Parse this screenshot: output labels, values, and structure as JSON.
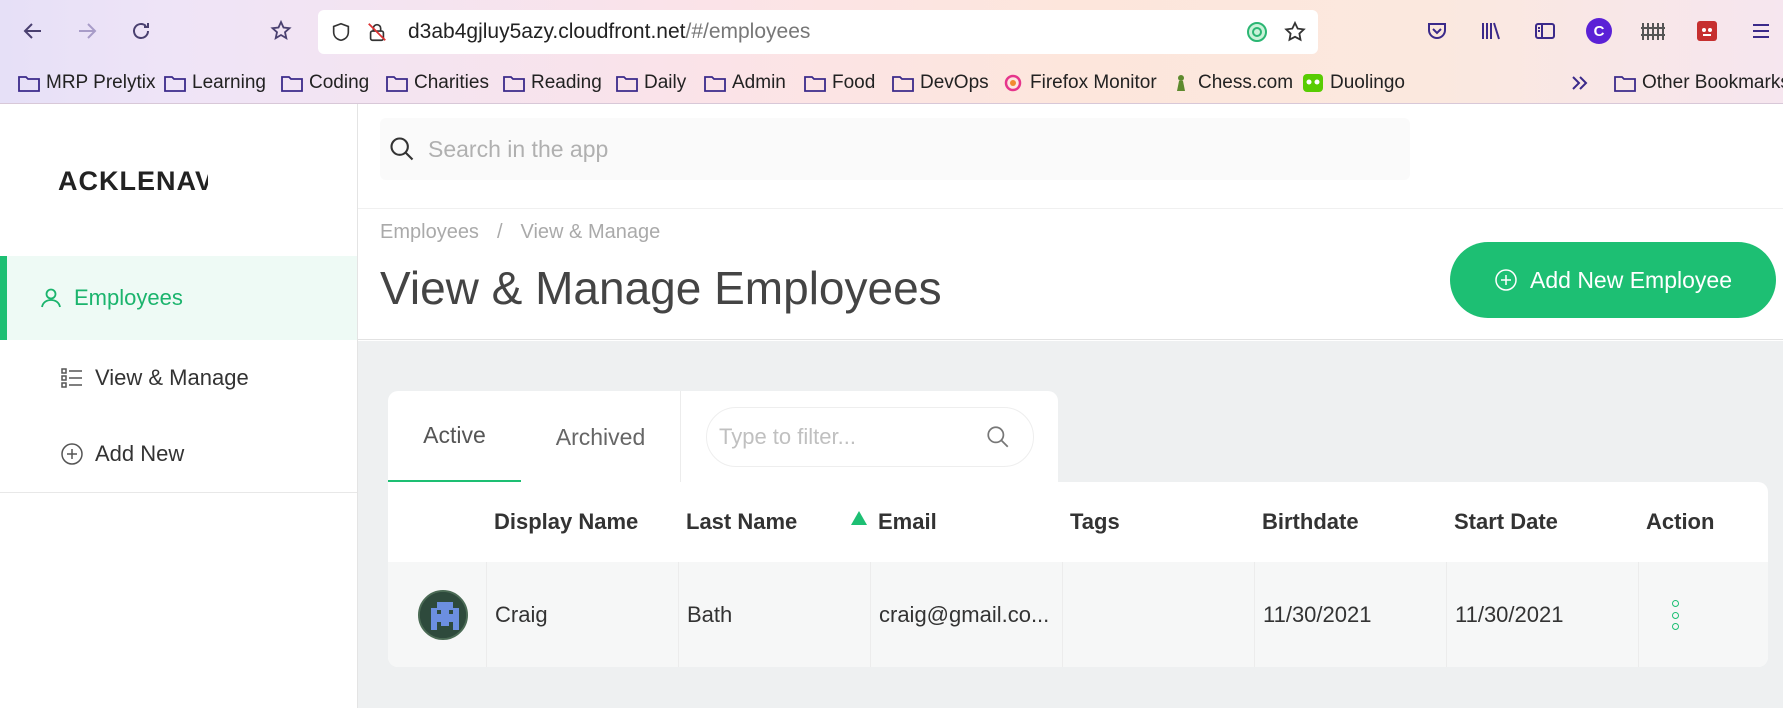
{
  "browser": {
    "url_host": "d3ab4gjluy5azy.cloudfront.net",
    "url_path": "/#/employees",
    "bookmarks": [
      {
        "label": "MRP Prelytix",
        "icon": "folder-icon"
      },
      {
        "label": "Learning",
        "icon": "folder-icon"
      },
      {
        "label": "Coding",
        "icon": "folder-icon"
      },
      {
        "label": "Charities",
        "icon": "folder-icon"
      },
      {
        "label": "Reading",
        "icon": "folder-icon"
      },
      {
        "label": "Daily",
        "icon": "folder-icon"
      },
      {
        "label": "Admin",
        "icon": "folder-icon"
      },
      {
        "label": "Food",
        "icon": "folder-icon"
      },
      {
        "label": "DevOps",
        "icon": "folder-icon"
      },
      {
        "label": "Firefox Monitor",
        "icon": "firefox-monitor-icon"
      },
      {
        "label": "Chess.com",
        "icon": "chess-pawn-icon"
      },
      {
        "label": "Duolingo",
        "icon": "duolingo-icon"
      },
      {
        "label": "Other Bookmarks",
        "icon": "folder-icon"
      }
    ],
    "profile_initial": "C"
  },
  "sidebar": {
    "logo": "ACKLENAV",
    "items": [
      {
        "label": "Employees",
        "icon": "user-icon",
        "active": true
      },
      {
        "label": "View & Manage",
        "icon": "list-icon"
      },
      {
        "label": "Add New",
        "icon": "plus-circle-icon"
      }
    ]
  },
  "search": {
    "placeholder": "Search in the app"
  },
  "header": {
    "breadcrumb": [
      "Employees",
      "/",
      "View & Manage"
    ],
    "title": "View & Manage Employees",
    "add_button": "Add New Employee"
  },
  "tabs": [
    {
      "label": "Active",
      "active": true
    },
    {
      "label": "Archived"
    }
  ],
  "filter": {
    "placeholder": "Type to filter..."
  },
  "table": {
    "columns": [
      "Display Name",
      "Last Name",
      "Email",
      "Tags",
      "Birthdate",
      "Start Date",
      "Action"
    ],
    "rows": [
      {
        "display_name": "Craig",
        "last_name": "Bath",
        "email": "craig@gmail.co...",
        "tags": "",
        "birthdate": "11/30/2021",
        "start_date": "11/30/2021"
      }
    ]
  },
  "colors": {
    "accent": "#1dbf73",
    "active_bg": "#eefaf5",
    "content_bg": "#eef0f1"
  }
}
